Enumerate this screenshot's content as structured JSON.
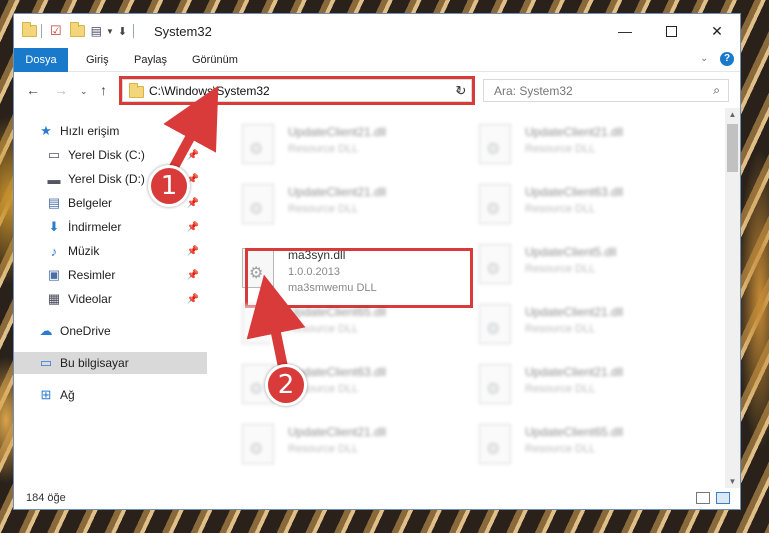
{
  "window": {
    "title": "System32",
    "minimize_icon": "minimize-icon",
    "maximize_icon": "maximize-icon",
    "close_icon": "close-icon"
  },
  "ribbon": {
    "tabs": [
      "Dosya",
      "Giriş",
      "Paylaş",
      "Görünüm"
    ],
    "expand_icon": "chevron-down-icon",
    "help_icon": "help-icon"
  },
  "nav": {
    "address": "C:\\Windows\\System32",
    "search_placeholder": "Ara: System32"
  },
  "sidebar": {
    "items": [
      {
        "label": "Hızlı erişim",
        "icon": "star-icon"
      },
      {
        "label": "Yerel Disk (C:)",
        "icon": "disk-icon"
      },
      {
        "label": "Yerel Disk (D:)",
        "icon": "disk-icon"
      },
      {
        "label": "Belgeler",
        "icon": "document-icon"
      },
      {
        "label": "İndirmeler",
        "icon": "download-icon"
      },
      {
        "label": "Müzik",
        "icon": "music-icon"
      },
      {
        "label": "Resimler",
        "icon": "pictures-icon"
      },
      {
        "label": "Videolar",
        "icon": "video-icon"
      },
      {
        "label": "OneDrive",
        "icon": "cloud-icon"
      },
      {
        "label": "Bu bilgisayar",
        "icon": "computer-icon"
      },
      {
        "label": "Ağ",
        "icon": "network-icon"
      }
    ]
  },
  "files": {
    "highlighted": {
      "name": "ma3syn.dll",
      "version": "1.0.0.2013",
      "description": "ma3smwemu DLL"
    },
    "left": [
      {
        "name": "UpdateClient21.dll",
        "desc": "Resource DLL"
      },
      {
        "name": "UpdateClient21.dll",
        "desc": "Resource DLL"
      },
      {
        "name": "UpdateClient65.dll",
        "desc": "Resource DLL"
      },
      {
        "name": "UpdateClient63.dll",
        "desc": "Resource DLL"
      },
      {
        "name": "UpdateClient21.dll",
        "desc": "Resource DLL"
      }
    ],
    "right": [
      {
        "name": "UpdateClient21.dll",
        "desc": "Resource DLL"
      },
      {
        "name": "UpdateClient63.dll",
        "desc": "Resource DLL"
      },
      {
        "name": "UpdateClient5.dll",
        "desc": "Resource DLL"
      },
      {
        "name": "UpdateClient21.dll",
        "desc": "Resource DLL"
      },
      {
        "name": "UpdateClient21.dll",
        "desc": "Resource DLL"
      },
      {
        "name": "UpdateClient65.dll",
        "desc": "Resource DLL"
      }
    ]
  },
  "status": {
    "count": "184 öğe"
  },
  "annotations": {
    "marker1": "1",
    "marker2": "2",
    "color": "#d93a3a"
  }
}
